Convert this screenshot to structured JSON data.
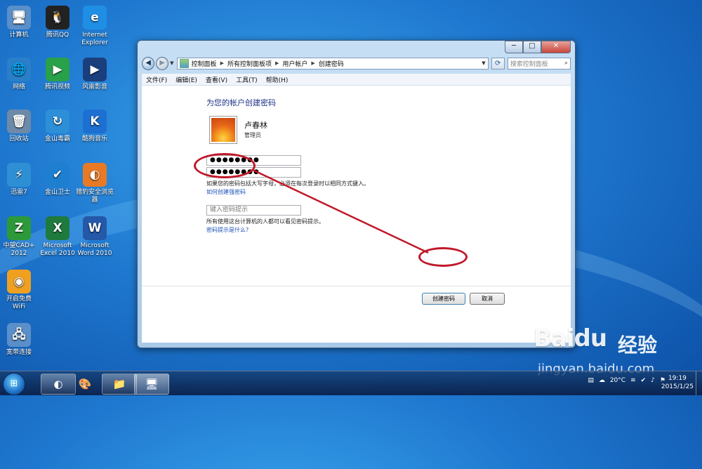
{
  "desktop": {
    "icons": [
      {
        "label": "计算机",
        "glyph": "🖥",
        "color": "#5b8fc9"
      },
      {
        "label": "腾讯QQ",
        "glyph": "🐧",
        "color": "#222222"
      },
      {
        "label": "Internet Explorer",
        "glyph": "e",
        "color": "#1f8fe6"
      },
      {
        "label": "网络",
        "glyph": "🌐",
        "color": "#2a7fc9"
      },
      {
        "label": "腾讯视频",
        "glyph": "▶",
        "color": "#29a04a"
      },
      {
        "label": "风雷影音",
        "glyph": "▶",
        "color": "#1b3f7d"
      },
      {
        "label": "回收站",
        "glyph": "🗑",
        "color": "#6d8aa8"
      },
      {
        "label": "金山毒霸",
        "glyph": "↻",
        "color": "#2c8fd8"
      },
      {
        "label": "酷狗音乐",
        "glyph": "K",
        "color": "#1d6fd1"
      },
      {
        "label": "迅雷7",
        "glyph": "⚡",
        "color": "#2e8fd4"
      },
      {
        "label": "金山卫士",
        "glyph": "✔",
        "color": "#1e7fd0"
      },
      {
        "label": "猎豹安全浏览器",
        "glyph": "◐",
        "color": "#e87a25"
      },
      {
        "label": "中望CAD+ 2012",
        "glyph": "Z",
        "color": "#2d9a3a"
      },
      {
        "label": "Microsoft Excel 2010",
        "glyph": "X",
        "color": "#1f7a3e"
      },
      {
        "label": "Microsoft Word 2010",
        "glyph": "W",
        "color": "#2458a8"
      },
      {
        "label": "开启免费WiFi",
        "glyph": "◉",
        "color": "#f0a020"
      },
      {
        "label": "宽带连接",
        "glyph": "🖧",
        "color": "#5b8fc9"
      }
    ]
  },
  "window": {
    "controls": {
      "minimize": "─",
      "maximize": "□",
      "close": "✕"
    },
    "nav": {
      "back": "◀",
      "forward": "▶",
      "dropdown": "▼",
      "refresh": "⟳"
    },
    "breadcrumbs": [
      "控制面板",
      "所有控制面板项",
      "用户帐户",
      "创建密码"
    ],
    "search_placeholder": "搜索控制面板",
    "menu": [
      "文件(F)",
      "编辑(E)",
      "查看(V)",
      "工具(T)",
      "帮助(H)"
    ]
  },
  "form": {
    "title": "为您的帐户创建密码",
    "username": "卢春林",
    "role": "管理员",
    "new_password": "",
    "confirm_password": "●●●●●●●●",
    "new_password_mask": "●●●●●●●●",
    "caps_note": "如果您的密码包括大写字母，必须在每次登录时以相同方式键入。",
    "strong_password_link": "如何创建强密码",
    "hint_placeholder": "键入密码提示",
    "hint_note": "所有使用这台计算机的人都可以看见密码提示。",
    "hint_link": "密码提示是什么?",
    "create_button": "创建密码",
    "cancel_button": "取消"
  },
  "watermark": {
    "logo": "Baidu",
    "suffix": "经验",
    "url": "jingyan.baidu.com"
  },
  "taskbar": {
    "start_glyph": "⊞",
    "pinned": [
      "◐",
      "🎨",
      "📁",
      "🖥"
    ],
    "tray": {
      "temperature": "20°C"
    },
    "clock": {
      "time": "19:19",
      "date": "2015/1/25"
    }
  },
  "colors": {
    "annotation_red": "#c0192a",
    "title_blue": "#1e3287",
    "link_blue": "#1a4fb5"
  }
}
